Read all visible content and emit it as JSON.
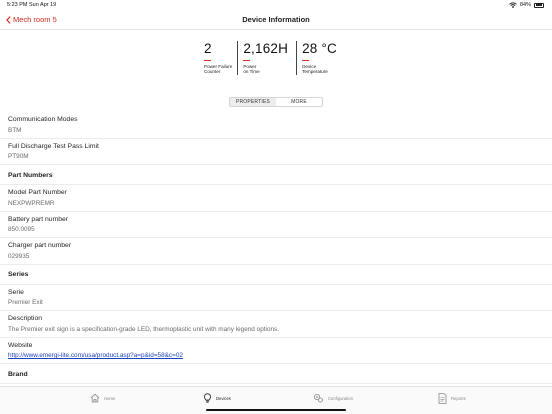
{
  "status_bar": {
    "time_date": "5:23 PM   Sun Apr 19",
    "battery": "84%",
    "battery_level": 0.84
  },
  "nav": {
    "back_label": "Mech room 5",
    "title": "Device Information"
  },
  "stats": [
    {
      "value": "2",
      "label_line1": "Power Failure",
      "label_line2": "Counter"
    },
    {
      "value": "2,162H",
      "label_line1": "Power",
      "label_line2": "on Time"
    },
    {
      "value": "28 °C",
      "label_line1": "Device",
      "label_line2": "Temperature"
    }
  ],
  "segments": {
    "properties": "PROPERTIES",
    "more": "MORE",
    "selected": "MORE"
  },
  "rows": {
    "comm_modes": {
      "label": "Communication Modes",
      "value": "BTM"
    },
    "discharge": {
      "label": "Full Discharge Test Pass Limit",
      "value": "PT90M"
    },
    "part_numbers_header": "Part Numbers",
    "model_part": {
      "label": "Model Part Number",
      "value": "NEXPWPREMR"
    },
    "battery_part": {
      "label": "Battery part number",
      "value": "850.0095"
    },
    "charger_part": {
      "label": "Charger part number",
      "value": "029935"
    },
    "series_header": "Series",
    "serie": {
      "label": "Serie",
      "value": "Premier Exit"
    },
    "description": {
      "label": "Description",
      "value": "The Premier exit sign is a specification-grade LED, thermoplastic unit with many legend options."
    },
    "website": {
      "label": "Website",
      "value": "http://www.emergi-lite.com/usa/product.asp?a=p&id=58&c=02"
    },
    "brand_header": "Brand"
  },
  "tabs": [
    {
      "label": "Home",
      "icon": "house-icon"
    },
    {
      "label": "Devices",
      "icon": "lightbulb-icon"
    },
    {
      "label": "Configuration",
      "icon": "gears-icon"
    },
    {
      "label": "Reports",
      "icon": "document-icon"
    }
  ],
  "colors": {
    "accent": "#cc2b1d",
    "link": "#1a3fbf"
  }
}
